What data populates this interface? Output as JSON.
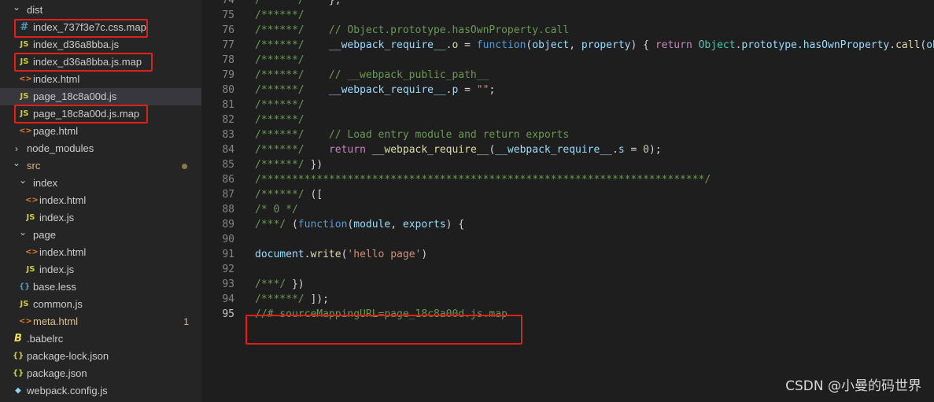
{
  "colors": {
    "highlight": "#e0201c",
    "js_icon": "#cbcb41",
    "html_icon": "#e37933",
    "css_icon": "#519aba",
    "json_icon": "#cbcb41"
  },
  "explorer": {
    "items": [
      {
        "label": "dist",
        "kind": "folder-open",
        "icon": "chevron-down-icon"
      },
      {
        "label": "index_737f3e7c.css.map",
        "kind": "file",
        "icon": "hash-icon",
        "glyph": "#"
      },
      {
        "label": "index_d36a8bba.js",
        "kind": "file",
        "icon": "js-icon",
        "glyph": "JS"
      },
      {
        "label": "index_d36a8bba.js.map",
        "kind": "file",
        "icon": "js-icon",
        "glyph": "JS"
      },
      {
        "label": "index.html",
        "kind": "file",
        "icon": "html-icon",
        "glyph": "<>"
      },
      {
        "label": "page_18c8a00d.js",
        "kind": "file",
        "icon": "js-icon",
        "glyph": "JS"
      },
      {
        "label": "page_18c8a00d.js.map",
        "kind": "file",
        "icon": "js-icon",
        "glyph": "JS"
      },
      {
        "label": "page.html",
        "kind": "file",
        "icon": "html-icon",
        "glyph": "<>"
      },
      {
        "label": "node_modules",
        "kind": "folder-closed",
        "icon": "chevron-right-icon"
      },
      {
        "label": "src",
        "kind": "folder-open",
        "icon": "chevron-down-icon"
      },
      {
        "label": "index",
        "kind": "folder-open",
        "icon": "chevron-down-icon"
      },
      {
        "label": "index.html",
        "kind": "file",
        "icon": "html-icon",
        "glyph": "<>"
      },
      {
        "label": "index.js",
        "kind": "file",
        "icon": "js-icon",
        "glyph": "JS"
      },
      {
        "label": "page",
        "kind": "folder-open",
        "icon": "chevron-down-icon"
      },
      {
        "label": "index.html",
        "kind": "file",
        "icon": "html-icon",
        "glyph": "<>"
      },
      {
        "label": "index.js",
        "kind": "file",
        "icon": "js-icon",
        "glyph": "JS"
      },
      {
        "label": "base.less",
        "kind": "file",
        "icon": "braces-icon",
        "glyph": "{}"
      },
      {
        "label": "common.js",
        "kind": "file",
        "icon": "js-icon",
        "glyph": "JS"
      },
      {
        "label": "meta.html",
        "kind": "file",
        "icon": "html-icon",
        "glyph": "<>",
        "badge": "1"
      },
      {
        "label": ".babelrc",
        "kind": "file",
        "icon": "babel-icon",
        "glyph": "B"
      },
      {
        "label": "package-lock.json",
        "kind": "file",
        "icon": "json-icon",
        "glyph": "{}"
      },
      {
        "label": "package.json",
        "kind": "file",
        "icon": "json-icon",
        "glyph": "{}"
      },
      {
        "label": "webpack.config.js",
        "kind": "file",
        "icon": "webpack-icon",
        "glyph": "◆"
      }
    ]
  },
  "editor": {
    "lines": [
      {
        "n": "74",
        "t": [
          [
            "c-com",
            "/******/"
          ],
          [
            "c-txt",
            "    };"
          ]
        ]
      },
      {
        "n": "75",
        "t": [
          [
            "c-com",
            "/******/"
          ]
        ]
      },
      {
        "n": "76",
        "t": [
          [
            "c-com",
            "/******/    // Object.prototype.hasOwnProperty.call"
          ]
        ]
      },
      {
        "n": "77",
        "t": [
          [
            "c-com",
            "/******/"
          ],
          [
            "c-txt",
            "    "
          ],
          [
            "c-var",
            "__webpack_require__"
          ],
          [
            "c-txt",
            "."
          ],
          [
            "c-fn",
            "o"
          ],
          [
            "c-txt",
            " = "
          ],
          [
            "c-kw",
            "function"
          ],
          [
            "c-txt",
            "("
          ],
          [
            "c-var",
            "object"
          ],
          [
            "c-txt",
            ", "
          ],
          [
            "c-var",
            "property"
          ],
          [
            "c-txt",
            ") { "
          ],
          [
            "c-kw2",
            "return"
          ],
          [
            "c-txt",
            " "
          ],
          [
            "c-cls",
            "Object"
          ],
          [
            "c-txt",
            "."
          ],
          [
            "c-var",
            "prototype"
          ],
          [
            "c-txt",
            "."
          ],
          [
            "c-var",
            "hasOwnProperty"
          ],
          [
            "c-txt",
            "."
          ],
          [
            "c-fn",
            "call"
          ],
          [
            "c-txt",
            "("
          ],
          [
            "c-var",
            "obj"
          ]
        ]
      },
      {
        "n": "78",
        "t": [
          [
            "c-com",
            "/******/"
          ]
        ]
      },
      {
        "n": "79",
        "t": [
          [
            "c-com",
            "/******/    // __webpack_public_path__"
          ]
        ]
      },
      {
        "n": "80",
        "t": [
          [
            "c-com",
            "/******/"
          ],
          [
            "c-txt",
            "    "
          ],
          [
            "c-var",
            "__webpack_require__"
          ],
          [
            "c-txt",
            "."
          ],
          [
            "c-var",
            "p"
          ],
          [
            "c-txt",
            " = "
          ],
          [
            "c-str",
            "\"\""
          ],
          [
            "c-txt",
            ";"
          ]
        ]
      },
      {
        "n": "81",
        "t": [
          [
            "c-com",
            "/******/"
          ]
        ]
      },
      {
        "n": "82",
        "t": [
          [
            "c-com",
            "/******/"
          ]
        ]
      },
      {
        "n": "83",
        "t": [
          [
            "c-com",
            "/******/    // Load entry module and return exports"
          ]
        ]
      },
      {
        "n": "84",
        "t": [
          [
            "c-com",
            "/******/"
          ],
          [
            "c-txt",
            "    "
          ],
          [
            "c-kw2",
            "return"
          ],
          [
            "c-txt",
            " "
          ],
          [
            "c-fn",
            "__webpack_require__"
          ],
          [
            "c-txt",
            "("
          ],
          [
            "c-var",
            "__webpack_require__"
          ],
          [
            "c-txt",
            "."
          ],
          [
            "c-var",
            "s"
          ],
          [
            "c-txt",
            " = "
          ],
          [
            "c-num",
            "0"
          ],
          [
            "c-txt",
            ");"
          ]
        ]
      },
      {
        "n": "85",
        "t": [
          [
            "c-com",
            "/******/"
          ],
          [
            "c-txt",
            " })"
          ]
        ]
      },
      {
        "n": "86",
        "t": [
          [
            "c-com",
            "/************************************************************************/"
          ]
        ]
      },
      {
        "n": "87",
        "t": [
          [
            "c-com",
            "/******/"
          ],
          [
            "c-txt",
            " (["
          ]
        ]
      },
      {
        "n": "88",
        "t": [
          [
            "c-com",
            "/* 0 */"
          ]
        ]
      },
      {
        "n": "89",
        "t": [
          [
            "c-com",
            "/***/"
          ],
          [
            "c-txt",
            " ("
          ],
          [
            "c-kw",
            "function"
          ],
          [
            "c-txt",
            "("
          ],
          [
            "c-var",
            "module"
          ],
          [
            "c-txt",
            ", "
          ],
          [
            "c-var",
            "exports"
          ],
          [
            "c-txt",
            ") {"
          ]
        ]
      },
      {
        "n": "90",
        "t": []
      },
      {
        "n": "91",
        "t": [
          [
            "c-var",
            "document"
          ],
          [
            "c-txt",
            "."
          ],
          [
            "c-fn",
            "write"
          ],
          [
            "c-txt",
            "("
          ],
          [
            "c-str",
            "'hello page'"
          ],
          [
            "c-txt",
            ")"
          ]
        ]
      },
      {
        "n": "92",
        "t": []
      },
      {
        "n": "93",
        "t": [
          [
            "c-com",
            "/***/"
          ],
          [
            "c-txt",
            " })"
          ]
        ]
      },
      {
        "n": "94",
        "t": [
          [
            "c-com",
            "/******/"
          ],
          [
            "c-txt",
            " ]);"
          ]
        ]
      },
      {
        "n": "95",
        "t": [
          [
            "c-com",
            "//# sourceMappingURL=page_18c8a00d.js.map"
          ]
        ]
      }
    ],
    "active_line": "95"
  },
  "watermark": "CSDN @小曼的码世界"
}
